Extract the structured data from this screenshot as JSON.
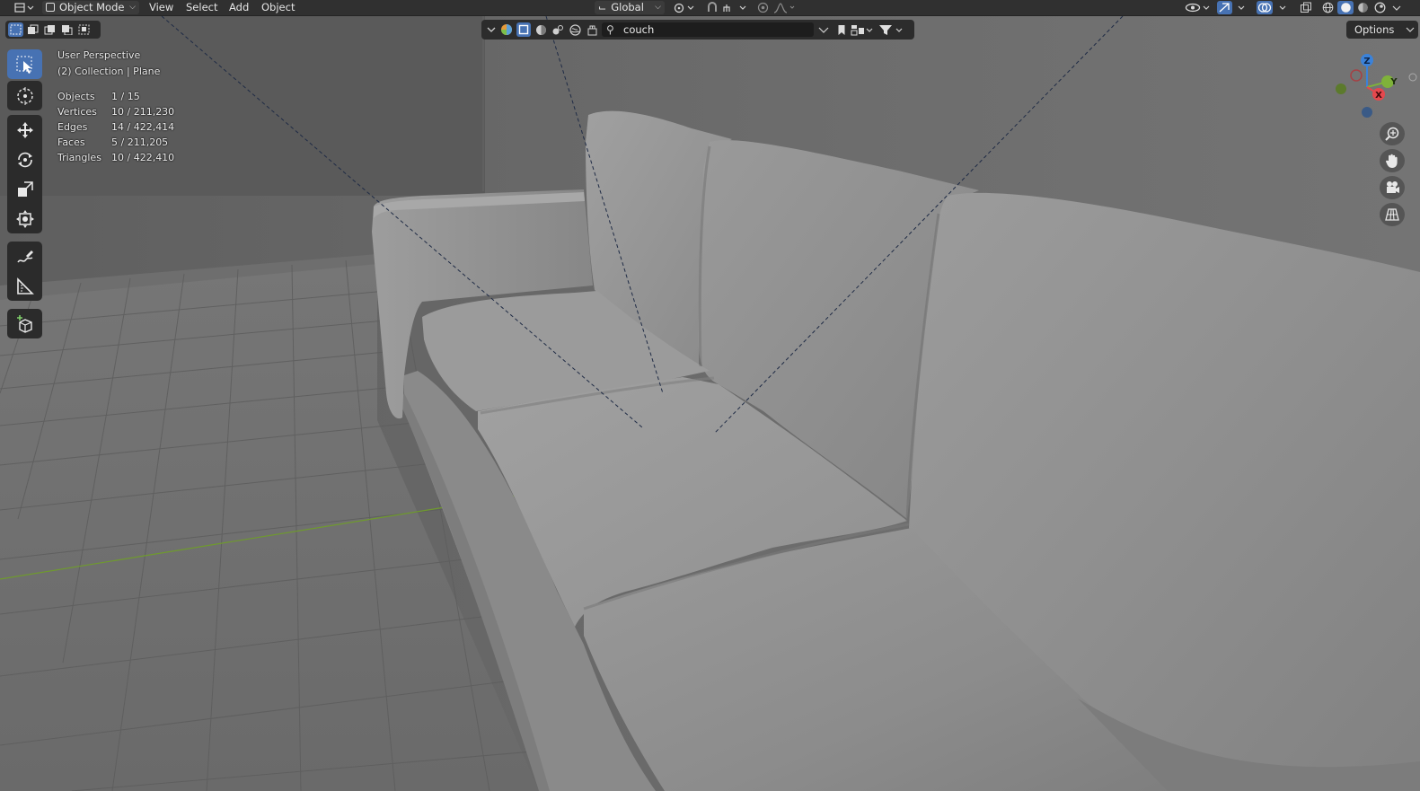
{
  "header": {
    "mode_label": "Object Mode",
    "menus": [
      "View",
      "Select",
      "Add",
      "Object"
    ],
    "transform_orientation": "Global"
  },
  "viewport": {
    "perspective_label": "User Perspective",
    "collection_label": "(2) Collection | Plane",
    "search_value": "couch",
    "options_label": "Options",
    "stats": [
      {
        "label": "Objects",
        "value": "1 / 15"
      },
      {
        "label": "Vertices",
        "value": "10 / 211,230"
      },
      {
        "label": "Edges",
        "value": "14 / 422,414"
      },
      {
        "label": "Faces",
        "value": "5 / 211,205"
      },
      {
        "label": "Triangles",
        "value": "10 / 422,410"
      }
    ],
    "gizmo": {
      "z": "Z",
      "y": "Y",
      "x": "X"
    }
  },
  "tools": [
    "select-box",
    "cursor",
    "move",
    "rotate",
    "scale",
    "transform",
    "annotate",
    "measure",
    "add-cube"
  ],
  "colors": {
    "accent": "#4772b3",
    "header": "#303030",
    "panel": "#2b2b2b",
    "x_axis": "#e5484d",
    "y_axis": "#7fb23a",
    "z_axis": "#3b82d9"
  }
}
